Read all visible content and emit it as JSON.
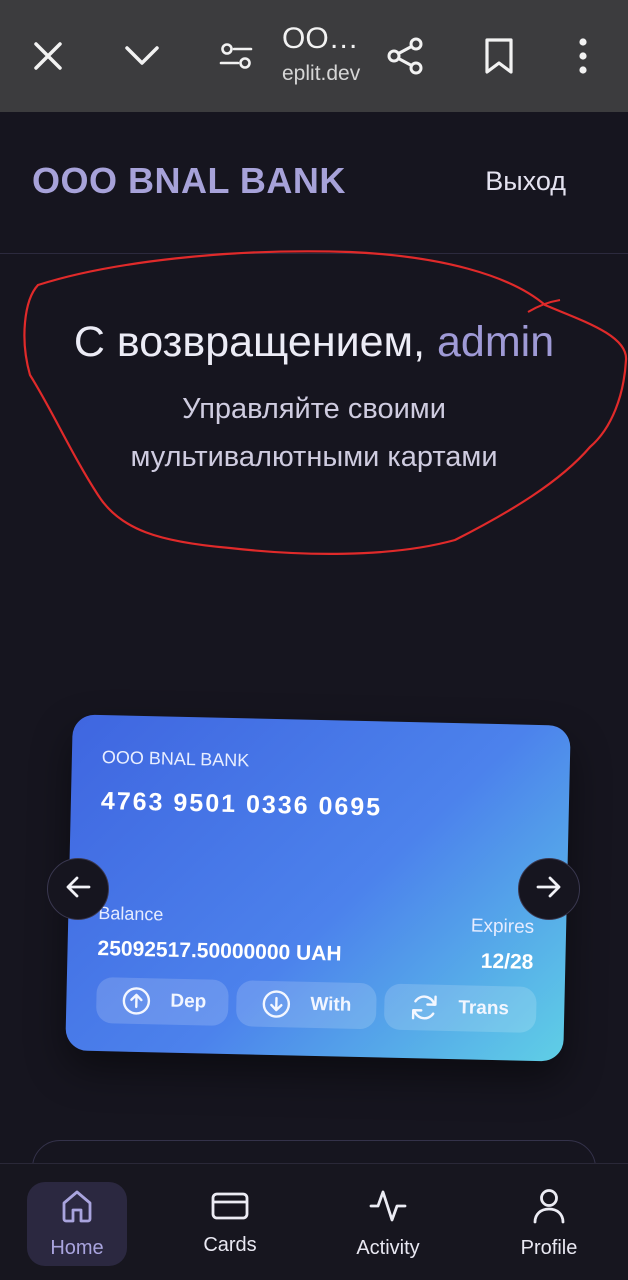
{
  "browser": {
    "title": "OO…",
    "url": "eplit.dev",
    "icons": [
      "close-icon",
      "chevron-down-icon",
      "page-settings-icon",
      "share-icon",
      "bookmark-icon",
      "more-vert-icon"
    ]
  },
  "header": {
    "brand": "OOO BNAL BANK",
    "logout": "Выход"
  },
  "welcome": {
    "greeting": "С возвращением,",
    "username": "admin",
    "subtitle_line1": "Управляйте своими",
    "subtitle_line2": "мультивалютными картами"
  },
  "card": {
    "bank": "OOO BNAL BANK",
    "number": "4763 9501 0336 0695",
    "balance_label": "Balance",
    "balance_value": "25092517.50000000 UAH",
    "expires_label": "Expires",
    "expires_value": "12/28",
    "actions": [
      {
        "label": "Dep",
        "icon": "arrow-up-circle-icon"
      },
      {
        "label": "With",
        "icon": "arrow-down-circle-icon"
      },
      {
        "label": "Trans",
        "icon": "refresh-icon"
      }
    ]
  },
  "bottom_nav": [
    {
      "label": "Home",
      "icon": "home-icon",
      "active": true
    },
    {
      "label": "Cards",
      "icon": "card-icon"
    },
    {
      "label": "Activity",
      "icon": "activity-icon"
    },
    {
      "label": "Profile",
      "icon": "user-icon"
    }
  ],
  "colors": {
    "background": "#16151f",
    "brand": "#a7a2d9",
    "card_start": "#3f66e0",
    "card_end": "#5fcfe6",
    "annotation": "#e02a2a"
  }
}
